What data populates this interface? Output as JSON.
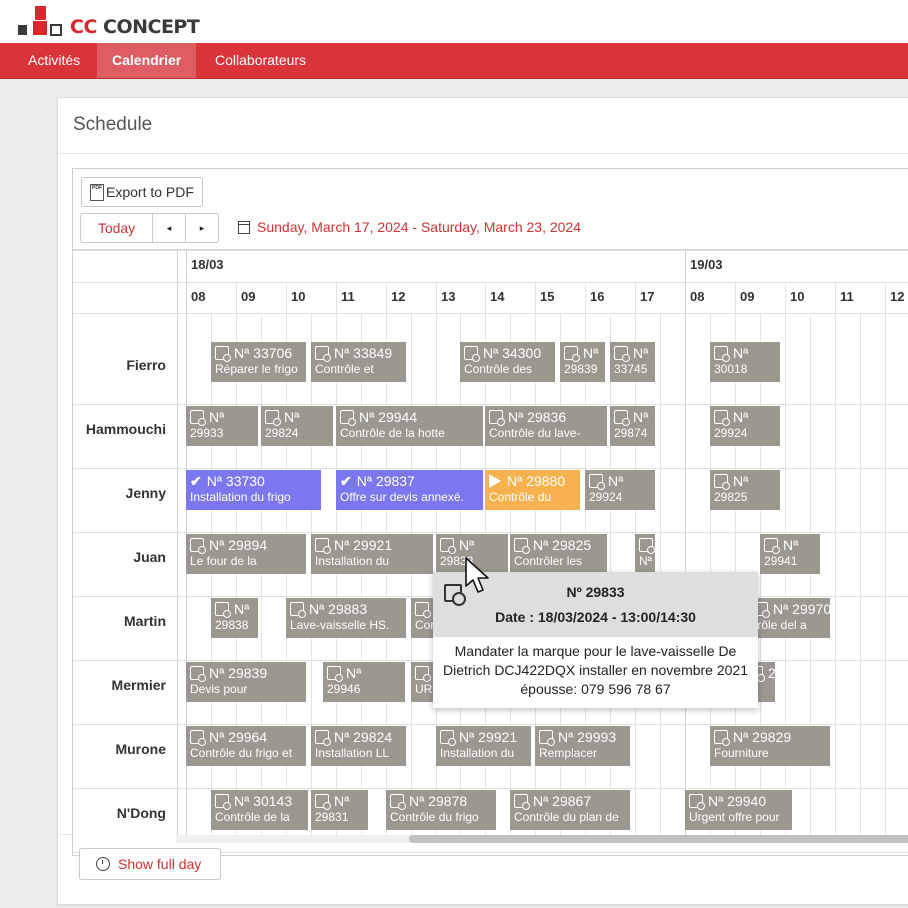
{
  "brand": {
    "name_prefix": "CC",
    "name_suffix": " CONCEPT"
  },
  "nav": {
    "items": [
      {
        "label": "Activités",
        "active": false
      },
      {
        "label": "Calendrier",
        "active": true
      },
      {
        "label": "Collaborateurs",
        "active": false
      }
    ]
  },
  "panel": {
    "title": "Schedule"
  },
  "toolbar": {
    "export_label": "Export to PDF",
    "pdf_icon_text": "PDF",
    "today_label": "Today",
    "prev_label": "◂",
    "next_label": "▸",
    "date_range": "Sunday, March 17, 2024 - Saturday, March 23, 2024"
  },
  "days": [
    "18/03",
    "19/03"
  ],
  "hours": [
    "08",
    "09",
    "10",
    "11",
    "12",
    "13",
    "14",
    "15",
    "16",
    "17",
    "08",
    "09",
    "10",
    "11",
    "12"
  ],
  "resources": [
    "Fierro",
    "Hammouchi",
    "Jenny",
    "Juan",
    "Martin",
    "Mermier",
    "Murone",
    "N'Dong"
  ],
  "events": [
    {
      "row": 0,
      "start": 0.5,
      "end": 2.4,
      "title": "Nª 33706",
      "desc": "Réparer le frigo",
      "style": "gray"
    },
    {
      "row": 0,
      "start": 2.5,
      "end": 4.4,
      "title": "Nª 33849",
      "desc": "Contrôle et",
      "style": "gray"
    },
    {
      "row": 0,
      "start": 5.5,
      "end": 7.4,
      "title": "Nª 34300",
      "desc": "Contrôle des",
      "style": "gray"
    },
    {
      "row": 0,
      "start": 7.5,
      "end": 8.4,
      "title": "Nª",
      "desc": "29839",
      "style": "gray"
    },
    {
      "row": 0,
      "start": 8.5,
      "end": 9.4,
      "title": "Nª",
      "desc": "33745",
      "style": "gray"
    },
    {
      "row": 0,
      "start": 10.5,
      "end": 11.9,
      "title": "Nª",
      "desc": "30018",
      "style": "gray"
    },
    {
      "row": 1,
      "start": 0,
      "end": 1.45,
      "title": "Nª",
      "desc": "29933",
      "style": "gray"
    },
    {
      "row": 1,
      "start": 1.5,
      "end": 2.95,
      "title": "Nª",
      "desc": "29824",
      "style": "gray"
    },
    {
      "row": 1,
      "start": 3,
      "end": 5.95,
      "title": "Nª 29944",
      "desc": "Contrôle de la hotte",
      "style": "gray"
    },
    {
      "row": 1,
      "start": 6,
      "end": 8.45,
      "title": "Nª 29836",
      "desc": "Contrôle du lave-",
      "style": "gray"
    },
    {
      "row": 1,
      "start": 8.5,
      "end": 9.4,
      "title": "Nª",
      "desc": "29874",
      "style": "gray"
    },
    {
      "row": 1,
      "start": 10.5,
      "end": 11.9,
      "title": "Nª",
      "desc": "29924",
      "style": "gray"
    },
    {
      "row": 2,
      "start": 0,
      "end": 2.7,
      "title": "Nª 33730",
      "desc": "Installation du frigo",
      "style": "purple"
    },
    {
      "row": 2,
      "start": 3,
      "end": 5.95,
      "title": "Nª 29837",
      "desc": "Offre sur devis annexé.",
      "style": "purple"
    },
    {
      "row": 2,
      "start": 6,
      "end": 7.9,
      "title": "Nª 29880",
      "desc": "Contrôle du",
      "style": "orange"
    },
    {
      "row": 2,
      "start": 8,
      "end": 9.4,
      "title": "Nª",
      "desc": "29924",
      "style": "gray"
    },
    {
      "row": 2,
      "start": 10.5,
      "end": 11.9,
      "title": "Nª",
      "desc": "29825",
      "style": "gray"
    },
    {
      "row": 3,
      "start": 0,
      "end": 2.4,
      "title": "Nª 29894",
      "desc": "Le four de la",
      "style": "gray"
    },
    {
      "row": 3,
      "start": 2.5,
      "end": 4.95,
      "title": "Nª 29921",
      "desc": "Installation du",
      "style": "gray"
    },
    {
      "row": 3,
      "start": 5,
      "end": 6.45,
      "title": "Nª",
      "desc": "29833",
      "style": "gray"
    },
    {
      "row": 3,
      "start": 6.5,
      "end": 8.45,
      "title": "Nª 29825",
      "desc": "Contrôler les",
      "style": "gray"
    },
    {
      "row": 3,
      "start": 9,
      "end": 9.4,
      "title": "",
      "desc": "Nª",
      "style": "gray"
    },
    {
      "row": 3,
      "start": 11.5,
      "end": 12.7,
      "title": "Nª",
      "desc": "29941",
      "style": "gray"
    },
    {
      "row": 4,
      "start": 0.5,
      "end": 1.45,
      "title": "Nª",
      "desc": "29838",
      "style": "gray"
    },
    {
      "row": 4,
      "start": 2,
      "end": 4.4,
      "title": "Nª 29883",
      "desc": "Lave-vaisselle HS.",
      "style": "gray"
    },
    {
      "row": 4,
      "start": 4.5,
      "end": 5.6,
      "title": "",
      "desc": "Con",
      "style": "gray"
    },
    {
      "row": 4,
      "start": 11.3,
      "end": 12.9,
      "title": "Nª 29970",
      "desc": "trôle del a",
      "style": "gray"
    },
    {
      "row": 5,
      "start": 0,
      "end": 2.4,
      "title": "Nª 29839",
      "desc": "Devis pour",
      "style": "gray"
    },
    {
      "row": 5,
      "start": 2.75,
      "end": 4.4,
      "title": "Nª",
      "desc": "29946",
      "style": "gray"
    },
    {
      "row": 5,
      "start": 4.5,
      "end": 5.6,
      "title": "",
      "desc": "URG",
      "style": "gray"
    },
    {
      "row": 5,
      "start": 11.2,
      "end": 11.8,
      "title": "2",
      "desc": "e",
      "style": "gray"
    },
    {
      "row": 6,
      "start": 0,
      "end": 2.4,
      "title": "Nª 29964",
      "desc": "Contrôle du frigo et",
      "style": "gray"
    },
    {
      "row": 6,
      "start": 2.5,
      "end": 4.4,
      "title": "Nª 29824",
      "desc": "Installation LL",
      "style": "gray"
    },
    {
      "row": 6,
      "start": 5,
      "end": 6.9,
      "title": "Nª 29921",
      "desc": "Installation du",
      "style": "gray"
    },
    {
      "row": 6,
      "start": 7,
      "end": 8.9,
      "title": "Nª 29993",
      "desc": "Remplacer",
      "style": "gray"
    },
    {
      "row": 6,
      "start": 10.5,
      "end": 12.9,
      "title": "Nª 29829",
      "desc": "Fourniture",
      "style": "gray"
    },
    {
      "row": 7,
      "start": 0.5,
      "end": 2.45,
      "title": "Nª 30143",
      "desc": "Contrôle de la",
      "style": "gray"
    },
    {
      "row": 7,
      "start": 2.5,
      "end": 3.65,
      "title": "Nª",
      "desc": "29831",
      "style": "gray"
    },
    {
      "row": 7,
      "start": 4,
      "end": 6.2,
      "title": "Nª 29878",
      "desc": "Contrôle du frigo",
      "style": "gray"
    },
    {
      "row": 7,
      "start": 6.5,
      "end": 8.9,
      "title": "Nª 29867",
      "desc": "Contrôle du plan de",
      "style": "gray"
    },
    {
      "row": 7,
      "start": 10,
      "end": 12.15,
      "title": "Nª 29940",
      "desc": "Urgent offre pour",
      "style": "gray"
    }
  ],
  "tooltip": {
    "number": "Nº 29833",
    "date": "Date : 18/03/2024 - 13:00/14:30",
    "lines": [
      "Mandater la marque pour le lave-vaisselle De",
      "Dietrich DCJ422DQX installer en novembre 2021",
      "épousse: 079 596 78 67"
    ]
  },
  "footer": {
    "show_full_day_label": "Show full day"
  }
}
